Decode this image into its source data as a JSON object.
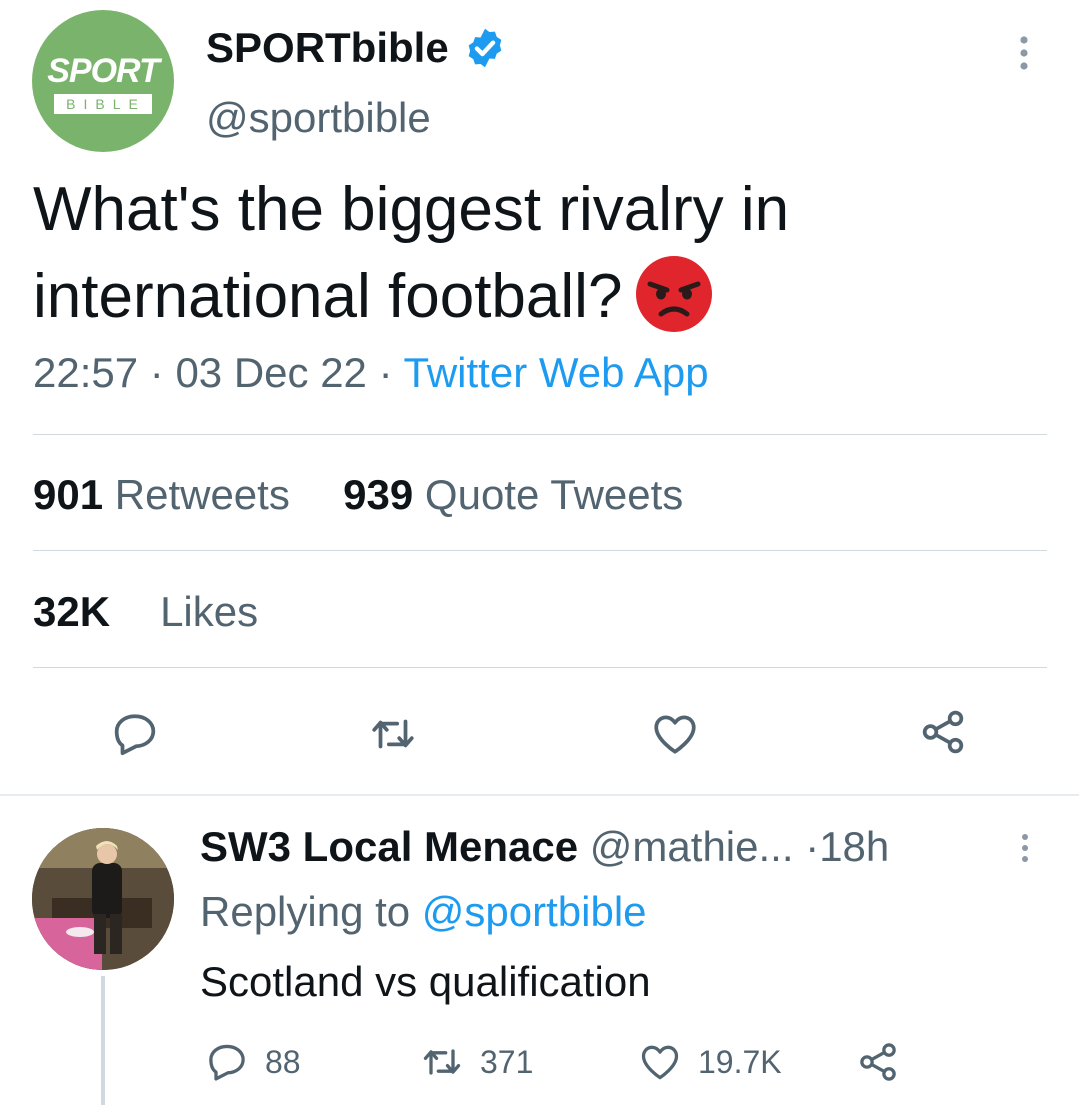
{
  "tweet": {
    "author": {
      "display_name": "SPORTbible",
      "handle": "@sportbible",
      "verified": true,
      "avatar_logo_top": "SPORT",
      "avatar_logo_bottom": "BIBLE",
      "avatar_color": "#7ab36b"
    },
    "text": "What's the biggest rivalry in international football?",
    "emoji": "angry-face",
    "time": "22:57",
    "date": "03 Dec 22",
    "source": "Twitter Web App",
    "separator": "·",
    "stats": {
      "retweets_count": "901",
      "retweets_label": "Retweets",
      "quotes_count": "939",
      "quotes_label": "Quote Tweets",
      "likes_count": "32K",
      "likes_label": "Likes"
    },
    "actions": [
      "reply-icon",
      "retweet-icon",
      "like-icon",
      "share-icon"
    ]
  },
  "reply": {
    "display_name": "SW3 Local Menace",
    "handle": "@mathie...",
    "time": "18h",
    "separator": "·",
    "replying_prefix": "Replying to",
    "replying_to": "@sportbible",
    "text": "Scotland vs qualification",
    "replies": "88",
    "retweets": "371",
    "likes": "19.7K"
  },
  "colors": {
    "accent": "#1d9bf0",
    "text": "#0f1419",
    "muted": "#536471",
    "divider": "#cfd9de"
  }
}
